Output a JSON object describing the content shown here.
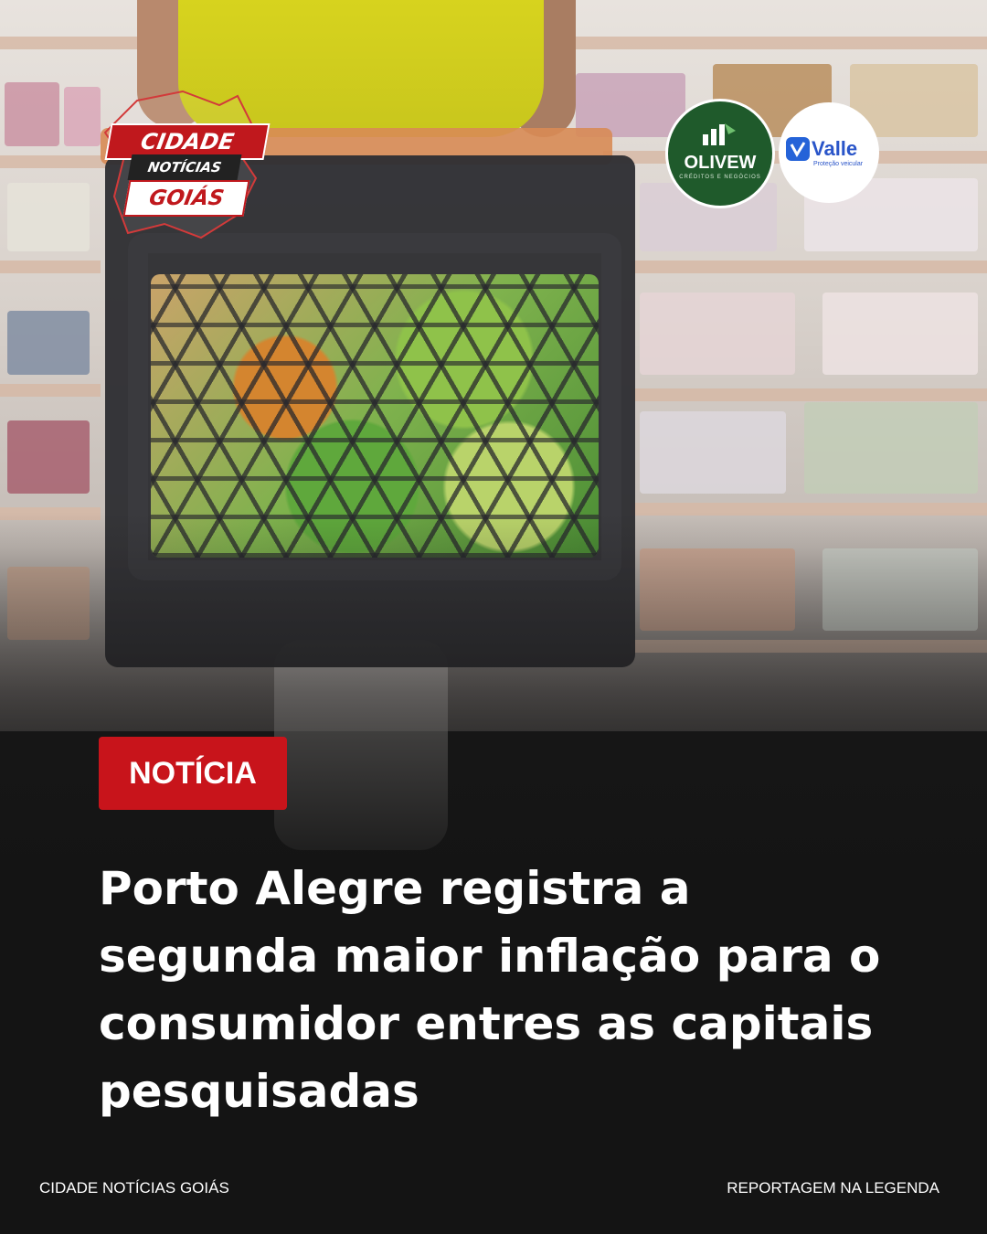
{
  "brand": {
    "line1": "CIDADE",
    "line2": "NOTÍCIAS",
    "line3": "GOIÁS"
  },
  "sponsors": [
    {
      "name": "OLIVEW",
      "tagline": "CRÉDITOS E NEGÓCIOS"
    },
    {
      "name": "Valle",
      "tagline": "Proteção veicular"
    }
  ],
  "tag": "NOTÍCIA",
  "headline": "Porto Alegre registra a segunda maior inflação para o consumidor entres as capitais pesquisadas",
  "footer": {
    "left": "CIDADE NOTÍCIAS GOIÁS",
    "right": "REPORTAGEM NA LEGENDA"
  },
  "colors": {
    "accent_red": "#c8141b",
    "olivew_green": "#1f5a2b",
    "valle_blue": "#2a55c9",
    "background": "#141414"
  }
}
